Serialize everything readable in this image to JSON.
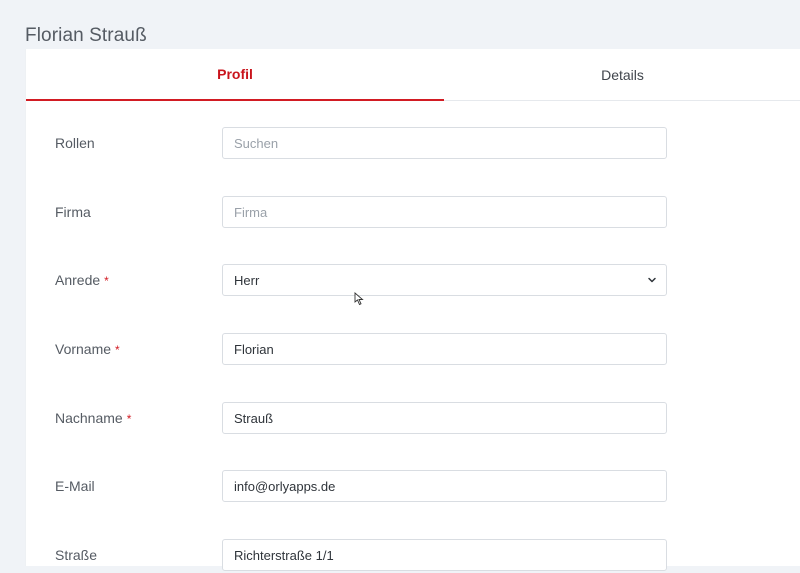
{
  "header": {
    "title": "Florian Strauß"
  },
  "tabs": [
    {
      "label": "Profil",
      "active": true
    },
    {
      "label": "Details",
      "active": false
    }
  ],
  "colors": {
    "accent": "#d21b23",
    "required": "#d21b23"
  },
  "form": {
    "rollen": {
      "label": "Rollen",
      "placeholder": "Suchen",
      "value": ""
    },
    "firma": {
      "label": "Firma",
      "placeholder": "Firma",
      "value": ""
    },
    "anrede": {
      "label": "Anrede",
      "required_mark": "*",
      "value": "Herr",
      "icon": "chevron-down-icon"
    },
    "vorname": {
      "label": "Vorname",
      "required_mark": "*",
      "value": "Florian"
    },
    "nachname": {
      "label": "Nachname",
      "required_mark": "*",
      "value": "Strauß"
    },
    "email": {
      "label": "E-Mail",
      "value": "info@orlyapps.de"
    },
    "strasse": {
      "label": "Straße",
      "value": "Richterstraße 1/1"
    }
  }
}
